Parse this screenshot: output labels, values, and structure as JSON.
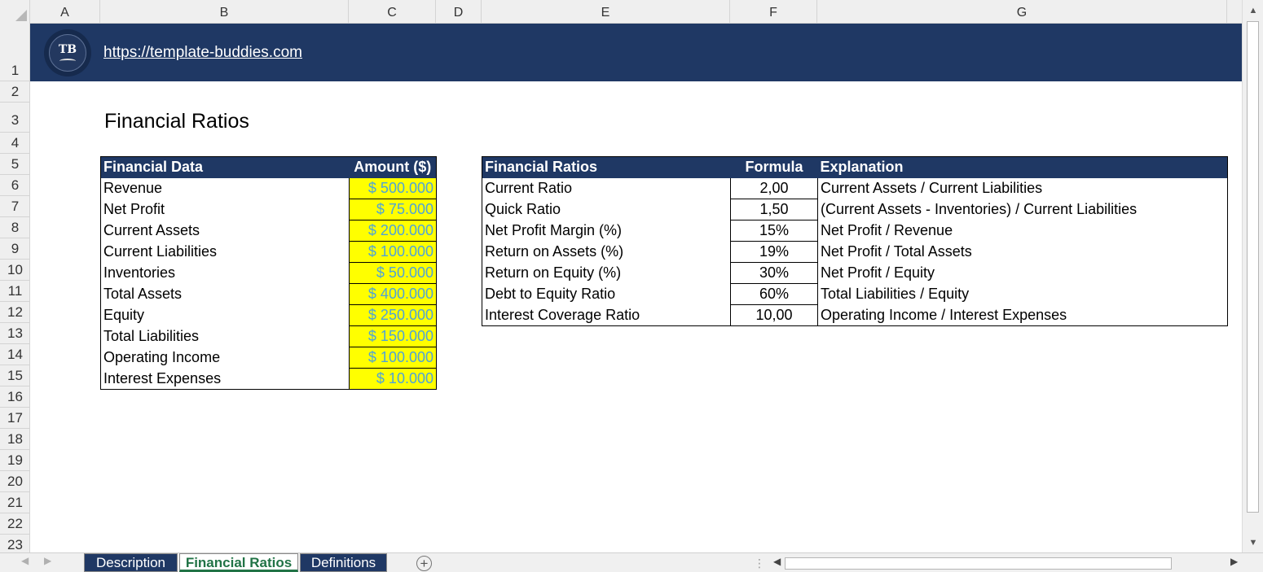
{
  "columns": [
    "A",
    "B",
    "C",
    "D",
    "E",
    "F",
    "G"
  ],
  "rows": [
    "1",
    "2",
    "3",
    "4",
    "5",
    "6",
    "7",
    "8",
    "9",
    "10",
    "11",
    "12",
    "13",
    "14",
    "15",
    "16",
    "17",
    "18",
    "19",
    "20",
    "21",
    "22",
    "23"
  ],
  "banner": {
    "logo_text": "TB",
    "link_text": "https://template-buddies.com",
    "color": "#1f3864"
  },
  "title": "Financial Ratios",
  "financial_data": {
    "headers": [
      "Financial Data",
      "Amount ($)"
    ],
    "rows": [
      {
        "label": "Revenue",
        "amount": "$ 500.000"
      },
      {
        "label": "Net Profit",
        "amount": "$ 75.000"
      },
      {
        "label": "Current Assets",
        "amount": "$ 200.000"
      },
      {
        "label": "Current Liabilities",
        "amount": "$ 100.000"
      },
      {
        "label": "Inventories",
        "amount": "$ 50.000"
      },
      {
        "label": "Total Assets",
        "amount": "$ 400.000"
      },
      {
        "label": "Equity",
        "amount": "$ 250.000"
      },
      {
        "label": "Total Liabilities",
        "amount": "$ 150.000"
      },
      {
        "label": "Operating Income",
        "amount": "$ 100.000"
      },
      {
        "label": "Interest Expenses",
        "amount": "$ 10.000"
      }
    ],
    "input_fill_color": "#ffff00"
  },
  "ratios": {
    "headers": [
      "Financial Ratios",
      "Formula",
      "Explanation"
    ],
    "rows": [
      {
        "name": "Current Ratio",
        "value": "2,00",
        "explanation": "Current Assets / Current Liabilities"
      },
      {
        "name": "Quick Ratio",
        "value": "1,50",
        "explanation": "(Current Assets - Inventories) / Current Liabilities"
      },
      {
        "name": "Net Profit Margin (%)",
        "value": "15%",
        "explanation": "Net Profit / Revenue"
      },
      {
        "name": "Return on Assets (%)",
        "value": "19%",
        "explanation": "Net Profit / Total Assets"
      },
      {
        "name": "Return on Equity (%)",
        "value": "30%",
        "explanation": "Net Profit / Equity"
      },
      {
        "name": "Debt to Equity Ratio",
        "value": "60%",
        "explanation": "Total Liabilities / Equity"
      },
      {
        "name": "Interest Coverage Ratio",
        "value": "10,00",
        "explanation": "Operating Income / Interest Expenses"
      }
    ]
  },
  "sheet_tabs": [
    {
      "label": "Description",
      "active": false
    },
    {
      "label": "Financial Ratios",
      "active": true
    },
    {
      "label": "Definitions",
      "active": false
    }
  ],
  "icons": {
    "add_sheet": "plus-circle-icon",
    "scroll_left": "triangle-left-icon",
    "scroll_right": "triangle-right-icon",
    "scroll_up": "triangle-up-icon",
    "scroll_down": "triangle-down-icon"
  }
}
